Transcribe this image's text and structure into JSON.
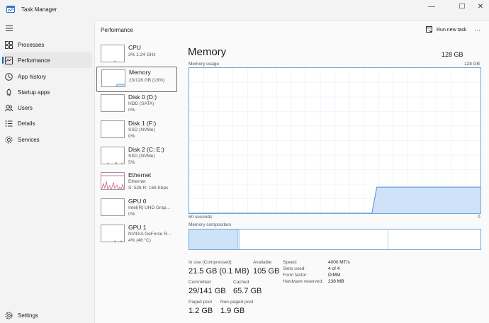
{
  "window": {
    "title": "Task Manager",
    "minimize_glyph": "—",
    "maximize_glyph": "☐",
    "close_glyph": "✕"
  },
  "nav": {
    "items": [
      {
        "label": "Processes",
        "icon": "processes-icon"
      },
      {
        "label": "Performance",
        "icon": "performance-icon",
        "active": true
      },
      {
        "label": "App history",
        "icon": "app-history-icon"
      },
      {
        "label": "Startup apps",
        "icon": "startup-apps-icon"
      },
      {
        "label": "Users",
        "icon": "users-icon"
      },
      {
        "label": "Details",
        "icon": "details-icon"
      },
      {
        "label": "Services",
        "icon": "services-icon"
      }
    ],
    "settings_label": "Settings"
  },
  "header": {
    "section_title": "Performance",
    "run_new_task_label": "Run new task",
    "more_glyph": "···"
  },
  "devices": [
    {
      "name": "CPU",
      "lines": [
        "3%  1.24 GHz"
      ]
    },
    {
      "name": "Memory",
      "lines": [
        "23/128 GB (18%)"
      ],
      "selected": true
    },
    {
      "name": "Disk 0 (D:)",
      "lines": [
        "HDD (SATA)",
        "0%"
      ]
    },
    {
      "name": "Disk 1 (F:)",
      "lines": [
        "SSD (NVMe)",
        "0%"
      ]
    },
    {
      "name": "Disk 2 (C: E:)",
      "lines": [
        "SSD (NVMe)",
        "5%"
      ]
    },
    {
      "name": "Ethernet",
      "lines": [
        "Ethernet",
        "S: 528  R: 168 Kbps"
      ]
    },
    {
      "name": "GPU 0",
      "lines": [
        "Intel(R) UHD Grap...",
        "0%"
      ]
    },
    {
      "name": "GPU 1",
      "lines": [
        "NVIDIA GeForce R...",
        "4% (48 °C)"
      ]
    }
  ],
  "memory": {
    "title": "Memory",
    "total": "128 GB",
    "usage_label": "Memory usage",
    "usage_max": "128 GB",
    "axis_left": "60 seconds",
    "axis_right": "0",
    "composition_label": "Memory composition",
    "usage_history_percent": [
      0,
      0,
      0,
      0,
      0,
      0,
      0,
      0,
      0,
      0,
      0,
      0,
      0,
      0,
      0,
      0,
      0,
      0,
      0,
      0,
      0,
      0,
      0,
      0,
      0,
      0,
      0,
      0,
      0,
      0,
      0,
      0,
      0,
      0,
      0,
      0,
      0,
      0,
      18,
      18,
      18,
      18,
      18,
      18,
      18,
      18,
      18,
      18,
      18,
      18,
      18,
      18,
      18,
      18,
      18,
      18,
      18,
      18,
      18,
      18
    ],
    "composition_fractions": {
      "in_use": 0.168,
      "modified": 0.004,
      "standby": 0.511,
      "free": 0.317
    },
    "stats": {
      "in_use_label": "In use (Compressed)",
      "in_use_value": "21.5 GB (0.1 MB)",
      "available_label": "Available",
      "available_value": "105 GB",
      "committed_label": "Committed",
      "committed_value": "29/141 GB",
      "cached_label": "Cached",
      "cached_value": "65.7 GB",
      "paged_pool_label": "Paged pool",
      "paged_pool_value": "1.2 GB",
      "non_paged_pool_label": "Non-paged pool",
      "non_paged_pool_value": "1.9 GB"
    },
    "specs": [
      {
        "key": "Speed:",
        "value": "4000 MT/s"
      },
      {
        "key": "Slots used:",
        "value": "4 of 4"
      },
      {
        "key": "Form factor:",
        "value": "DIMM"
      },
      {
        "key": "Hardware reserved:",
        "value": "238 MB"
      }
    ]
  },
  "colors": {
    "accent": "#0067c0",
    "memory_fill": "#cfe3f8",
    "memory_line": "#4a90d9",
    "gpu_line": "#a84ac2",
    "ethernet_line": "#d04a8a",
    "disk_line": "#6a9a2a"
  }
}
